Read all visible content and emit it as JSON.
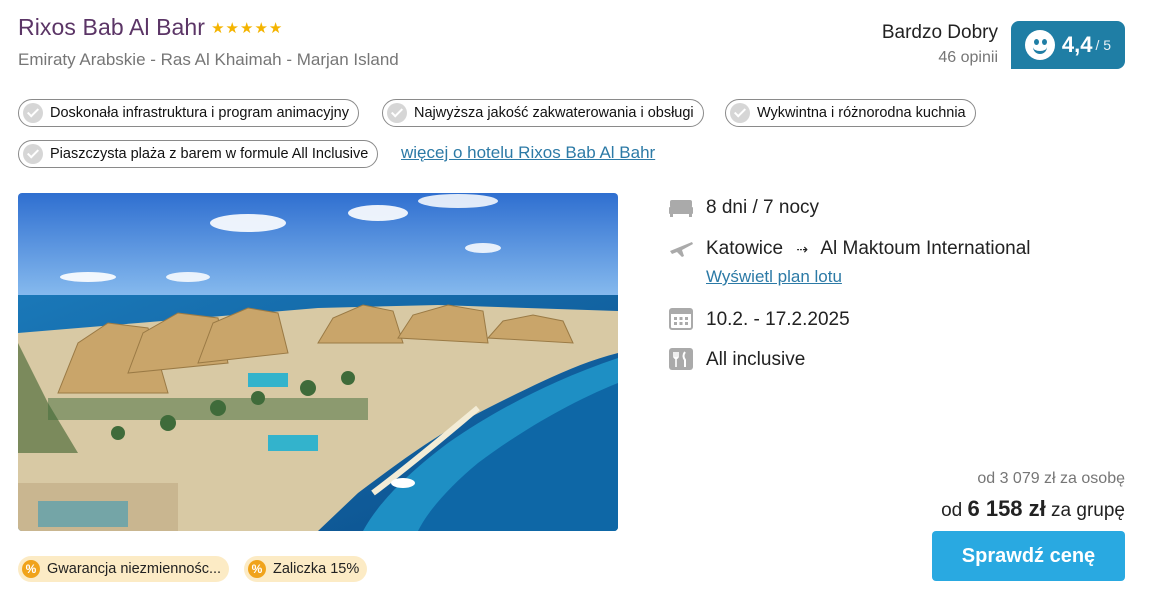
{
  "hotel": {
    "name": "Rixos Bab Al Bahr",
    "stars": 5,
    "location": "Emiraty Arabskie - Ras Al Khaimah - Marjan Island"
  },
  "rating": {
    "label": "Bardzo Dobry",
    "count": "46 opinii",
    "score": "4,4",
    "max": "/ 5"
  },
  "tags": [
    "Doskonała infrastruktura i program animacyjny",
    "Najwyższa jakość zakwaterowania i obsługi",
    "Wykwintna i różnorodna kuchnia",
    "Piaszczysta plaża z barem w formule All Inclusive"
  ],
  "more_link": "więcej o hotelu Rixos Bab Al Bahr",
  "details": {
    "duration": "8 dni / 7 nocy",
    "from": "Katowice",
    "arrow": "⇢",
    "to": "Al Maktoum International",
    "flight_plan_link": "Wyświetl plan lotu",
    "dates": "10.2. - 17.2.2025",
    "board": "All inclusive"
  },
  "price": {
    "per_person": "od 3 079 zł za osobę",
    "group_prefix": "od",
    "group_value": "6 158 zł",
    "group_suffix": "za grupę"
  },
  "cta": "Sprawdź cenę",
  "badges": [
    "Gwarancja niezmiennośc...",
    "Zaliczka 15%"
  ],
  "icons": {
    "star": "star-icon",
    "check": "check-icon",
    "bed": "bed-icon",
    "plane": "plane-icon",
    "calendar": "calendar-icon",
    "food": "cutlery-icon",
    "percent": "percent-icon"
  },
  "colors": {
    "hotel_name": "#5b3566",
    "rating_badge": "#1f7ea5",
    "link": "#2c7aa6",
    "cta": "#29a9e1",
    "badge_bg": "#fcebc5",
    "badge_icon": "#f0a31b",
    "star": "#f4b400"
  }
}
